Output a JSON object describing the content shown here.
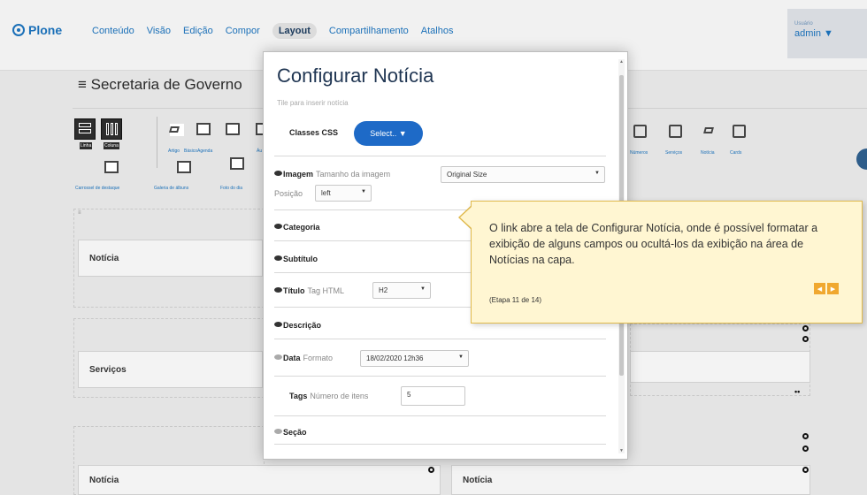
{
  "toolbar": {
    "logo": "Plone",
    "menu": [
      "Conteúdo",
      "Visão",
      "Edição",
      "Compor",
      "Layout",
      "Compartilhamento",
      "Atalhos"
    ],
    "active_menu": "Layout",
    "user_label": "Usuário",
    "user_name": "admin ▼"
  },
  "page": {
    "title": "≡ Secretaria de Governo"
  },
  "palette": {
    "big": [
      {
        "name": "Linha"
      },
      {
        "name": "Coluna"
      }
    ],
    "tiles": [
      "Artigo",
      "Básico",
      "Agenda",
      "Áu"
    ],
    "tiles_row2": [
      "Carrossel de destaque",
      "Galeria de álbuns",
      "Foto do dia"
    ],
    "right_tiles": [
      "Números",
      "Serviços",
      "Notícia",
      "Cards"
    ]
  },
  "grid": {
    "cells": [
      "Notícia",
      "Serviços",
      "Notícia",
      "Notícia"
    ]
  },
  "modal": {
    "title": "Configurar Notícia",
    "subtitle": "Tile para inserir notícia",
    "css_label": "Classes CSS",
    "css_button": "Select.. ▼",
    "image_field": "Imagem",
    "image_hint": "Tamanho da imagem",
    "image_size": "Original Size",
    "position_hint": "Posição",
    "position_value": "left",
    "category": "Categoria",
    "subtitle_field": "Subtítulo",
    "title_field": "Título",
    "title_hint": "Tag HTML",
    "title_tag": "H2",
    "description": "Descrição",
    "date_field": "Data",
    "date_hint": "Formato",
    "date_format": "18/02/2020 12h36",
    "tags_field": "Tags",
    "tags_hint": "Número de itens",
    "tags_count": "5",
    "section": "Seção"
  },
  "tooltip": {
    "text": "O link abre a tela de Configurar Notícia, onde é possível formatar a exibição de alguns campos ou ocultá-los da exibição na área de Notícias na capa.",
    "step": "(Etapa 11 de 14)",
    "prev": "◀",
    "next": "▶"
  },
  "colors": {
    "accent": "#1b70b8",
    "select_button": "#1e6ac7",
    "tooltip_bg": "#fff6d2",
    "tooltip_nav": "#f0a830"
  }
}
